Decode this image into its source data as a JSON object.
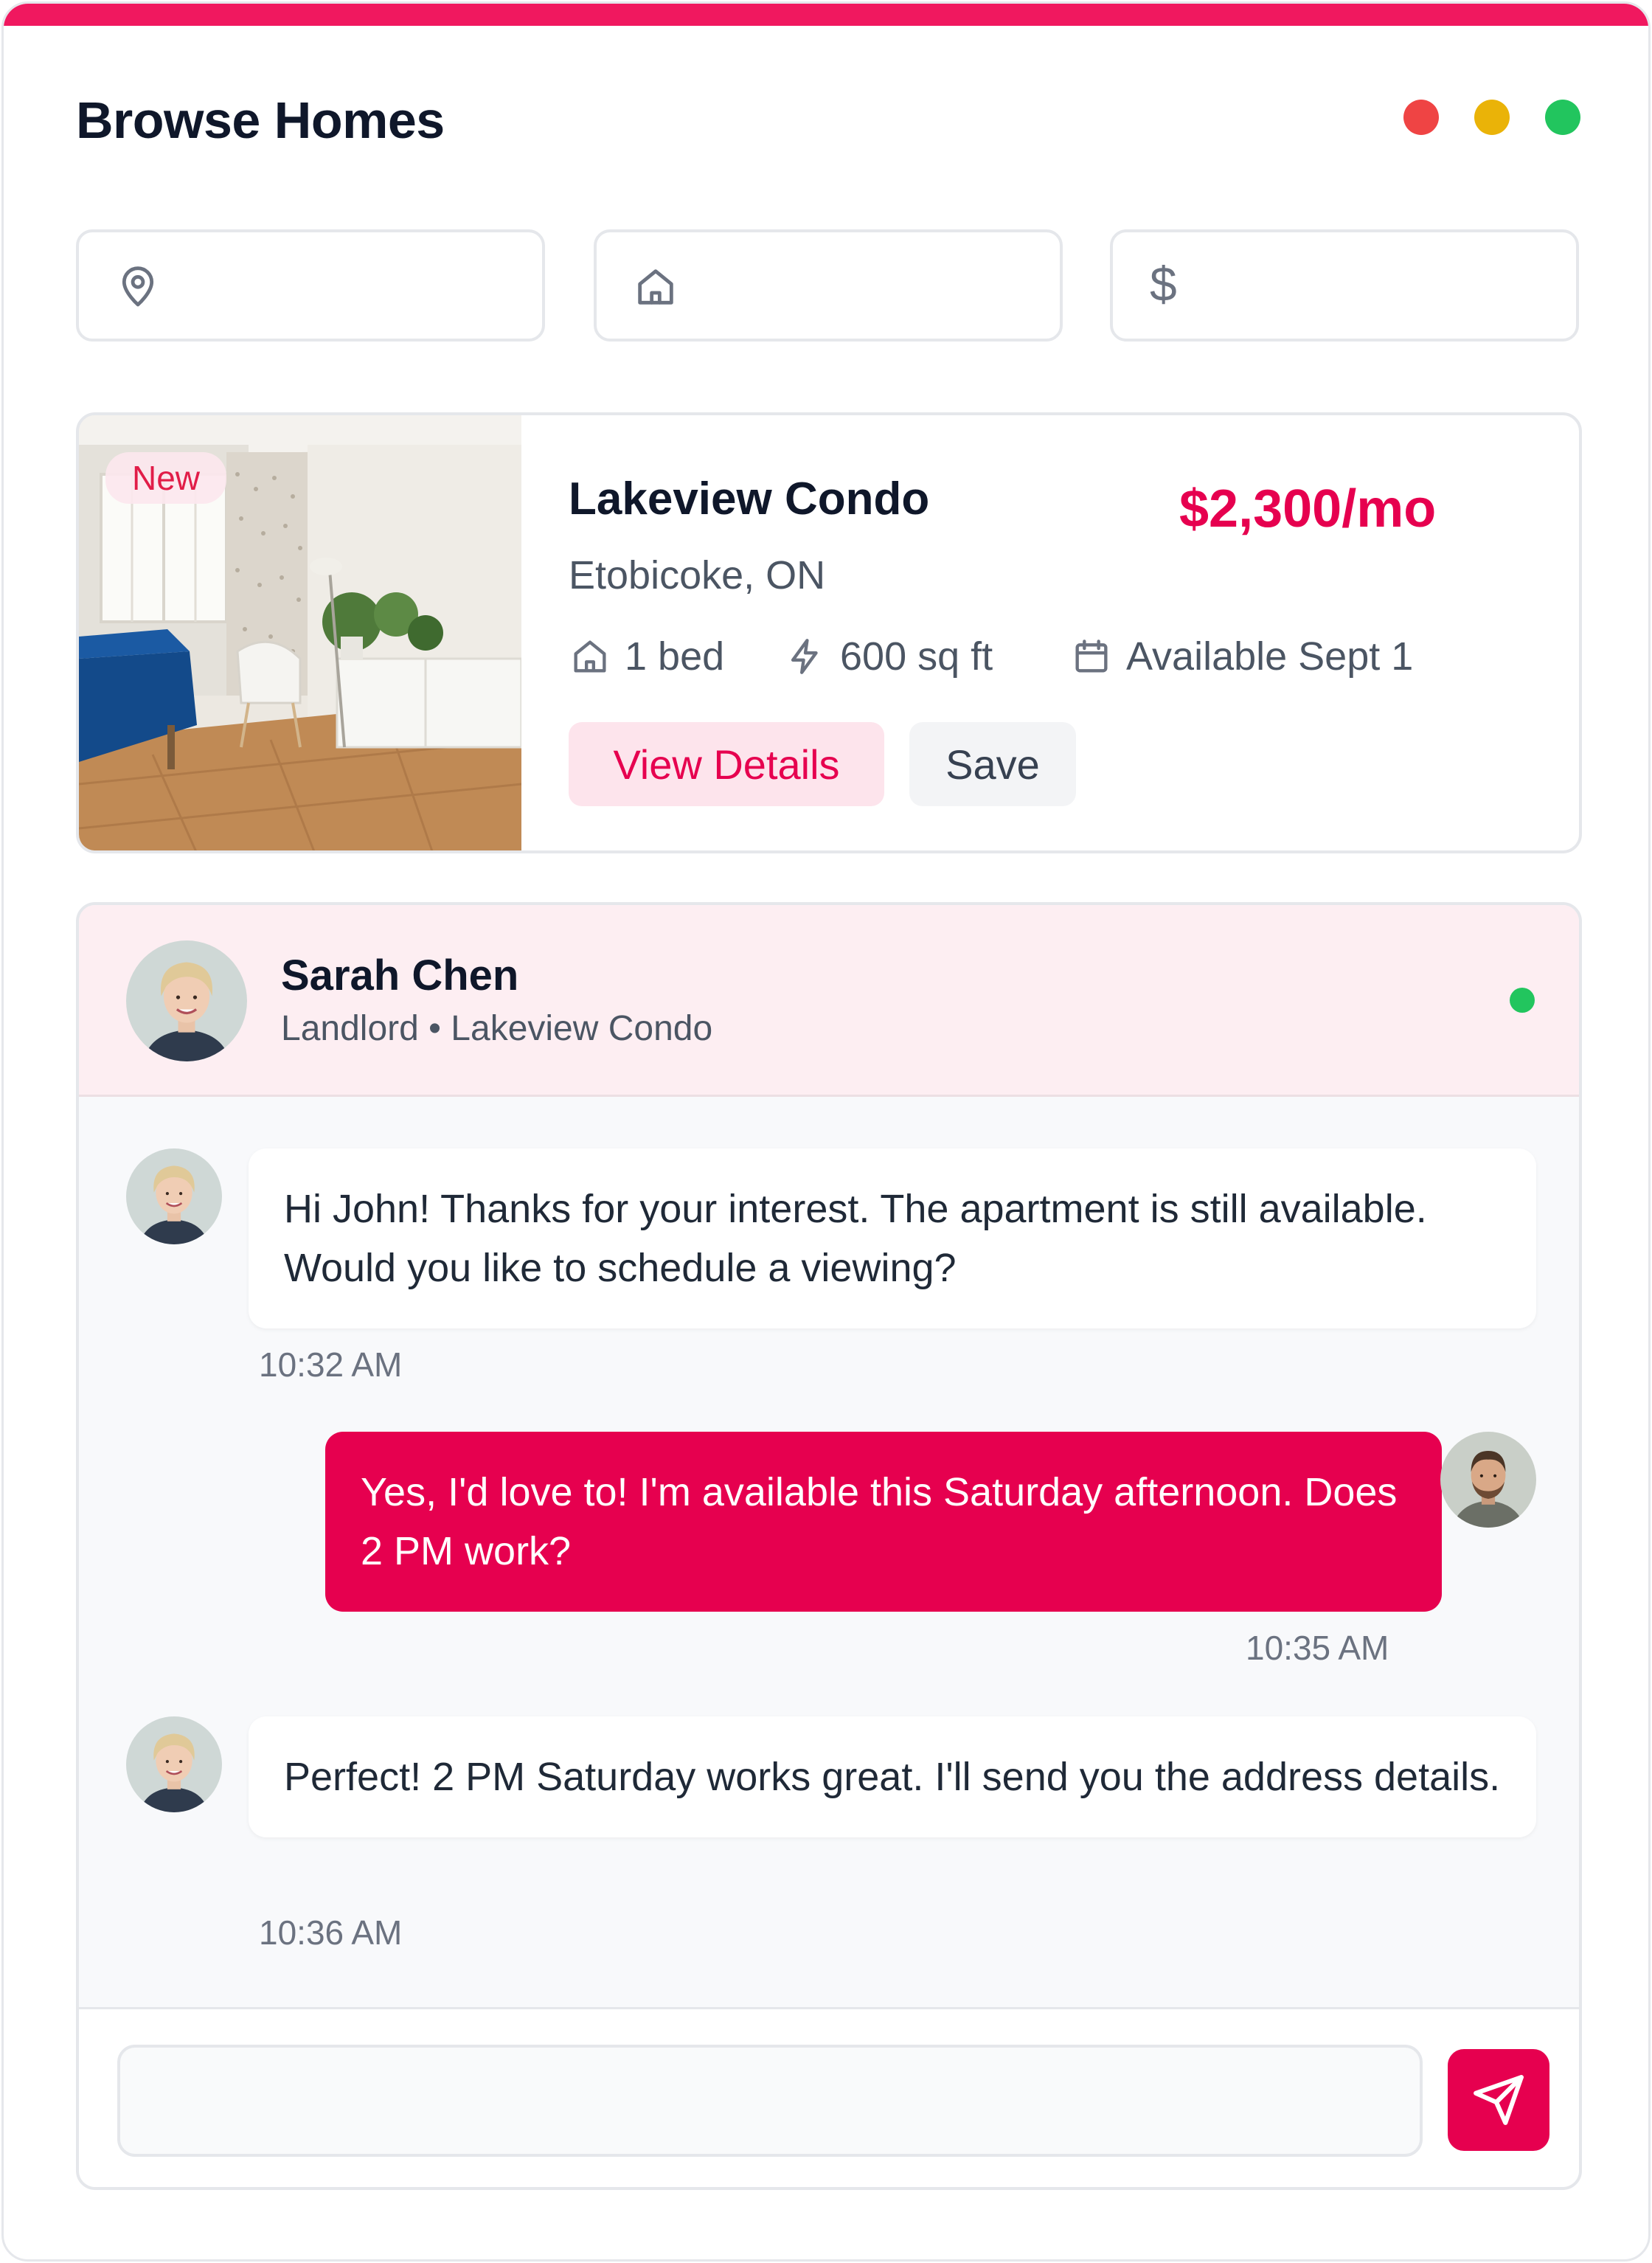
{
  "app": {
    "title": "Browse Homes",
    "accent_color": "#e6004f"
  },
  "window_controls": [
    "close",
    "minimize",
    "maximize"
  ],
  "filters": {
    "location": {
      "icon": "map-pin-icon",
      "value": ""
    },
    "property_type": {
      "icon": "home-icon",
      "value": ""
    },
    "price": {
      "icon": "dollar-icon",
      "symbol": "$",
      "value": ""
    }
  },
  "listing": {
    "badge": "New",
    "title": "Lakeview Condo",
    "price": "$2,300/mo",
    "location": "Etobicoke, ON",
    "beds": "1 bed",
    "size": "600 sq ft",
    "availability": "Available Sept 1",
    "view_details_label": "View Details",
    "save_label": "Save"
  },
  "chat": {
    "contact": {
      "name": "Sarah Chen",
      "subtitle": "Landlord • Lakeview Condo",
      "online": true
    },
    "messages": [
      {
        "sender": "Sarah Chen",
        "direction": "incoming",
        "text": "Hi John! Thanks for your interest. The apartment is still available. Would you like to schedule a viewing?",
        "time": "10:32 AM"
      },
      {
        "sender": "John",
        "direction": "outgoing",
        "text": "Yes, I'd love to! I'm available this Saturday afternoon. Does 2 PM work?",
        "time": "10:35 AM"
      },
      {
        "sender": "Sarah Chen",
        "direction": "incoming",
        "text": "Perfect! 2 PM Saturday works great. I'll send you the address details.",
        "time": "10:36 AM"
      }
    ],
    "composer": {
      "placeholder": "",
      "send_icon": "send-icon"
    }
  }
}
